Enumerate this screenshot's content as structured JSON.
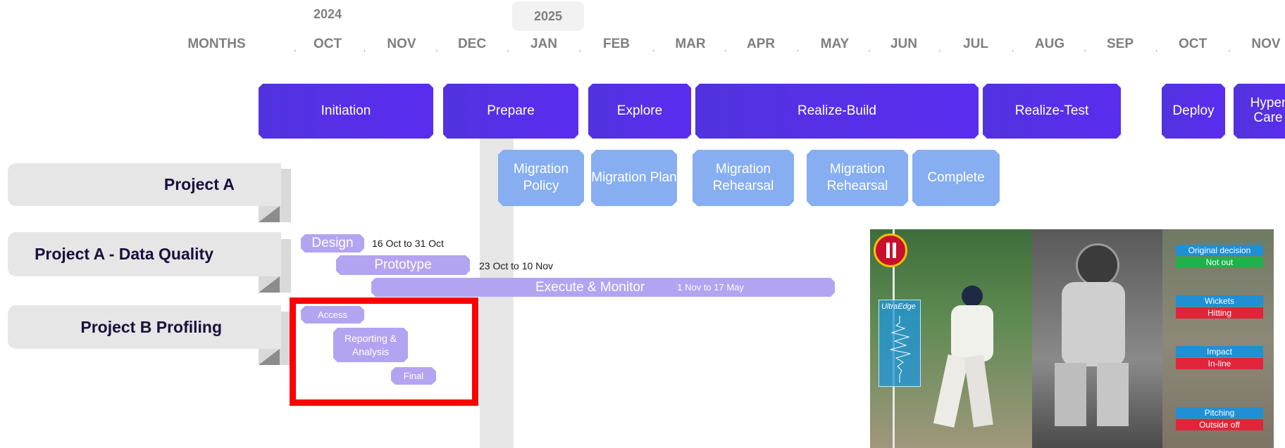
{
  "timeline": {
    "years": [
      "2024",
      "2025"
    ],
    "months_label": "MONTHS",
    "months": [
      "OCT",
      "NOV",
      "DEC",
      "JAN",
      "FEB",
      "MAR",
      "APR",
      "MAY",
      "JUN",
      "JUL",
      "AUG",
      "SEP",
      "OCT",
      "NOV"
    ]
  },
  "phases": [
    "Initiation",
    "Prepare",
    "Explore",
    "Realize-Build",
    "Realize-Test",
    "Deploy",
    "Hyper Care"
  ],
  "subphases": [
    "Migration Policy",
    "Migration Plan",
    "Migration Rehearsal",
    "Migration Rehearsal",
    "Complete"
  ],
  "projects": [
    "Project A",
    "Project A - Data Quality",
    "Project B Profiling"
  ],
  "data_quality_tasks": {
    "design": "Design",
    "design_dates": "16 Oct to 31 Oct",
    "prototype": "Prototype",
    "prototype_dates": "23 Oct to 10 Nov",
    "execute": "Execute & Monitor",
    "execute_dates": "1 Nov to 17 May"
  },
  "profiling_tasks": {
    "access": "Access",
    "reporting": "Reporting & Analysis",
    "final": "Final"
  },
  "review_panel": {
    "ultraedge": "UltraEdge",
    "decisions": [
      {
        "label": "Original decision",
        "value": "Not out",
        "value_color": "#1fb14a"
      },
      {
        "label": "Wickets",
        "value": "Hitting",
        "value_color": "#e0243a"
      },
      {
        "label": "Impact",
        "value": "In-line",
        "value_color": "#e0243a"
      },
      {
        "label": "Pitching",
        "value": "Outside off",
        "value_color": "#e0243a"
      }
    ]
  },
  "colors": {
    "phase": "#5a2df0",
    "subphase": "#86aef0",
    "task": "#b3a4f2",
    "highlight_box": "#ff0000"
  }
}
